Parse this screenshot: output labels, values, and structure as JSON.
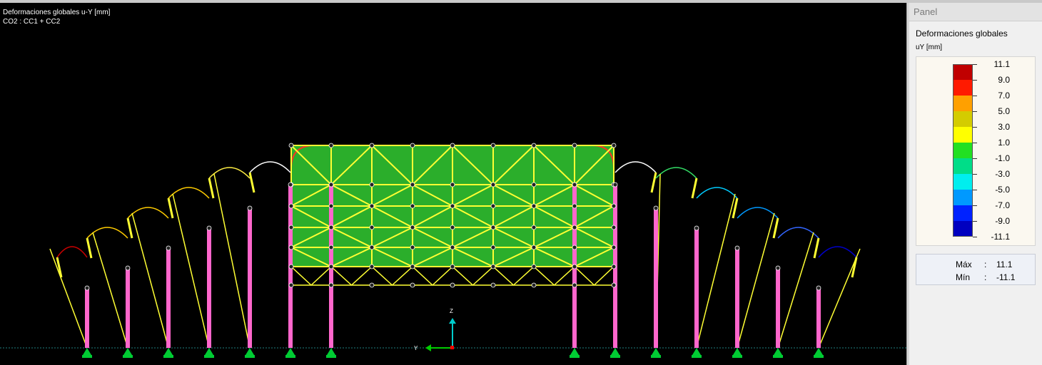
{
  "viewport": {
    "title": "Deformaciones globales u-Y [mm]",
    "load_combo": "CO2 : CC1 + CC2",
    "axis_z": "Z",
    "axis_y": "Y"
  },
  "panel": {
    "header": "Panel",
    "title": "Deformaciones globales",
    "unit": "uY [mm]",
    "legend": [
      {
        "value": "11.1",
        "color": "#c00000"
      },
      {
        "value": "9.0",
        "color": "#ff1a00"
      },
      {
        "value": "7.0",
        "color": "#ffa000"
      },
      {
        "value": "5.0",
        "color": "#d4cc00"
      },
      {
        "value": "3.0",
        "color": "#ffff00"
      },
      {
        "value": "1.0",
        "color": "#22e022"
      },
      {
        "value": "-1.0",
        "color": "#00dd88"
      },
      {
        "value": "-3.0",
        "color": "#00eeee"
      },
      {
        "value": "-5.0",
        "color": "#0099ff"
      },
      {
        "value": "-7.0",
        "color": "#0022ff"
      },
      {
        "value": "-9.0",
        "color": "#0000c0"
      },
      {
        "value": "-11.1",
        "color": ""
      }
    ],
    "max_label": "Máx",
    "max_value": "11.1",
    "min_label": "Mín",
    "min_value": "-11.1"
  }
}
